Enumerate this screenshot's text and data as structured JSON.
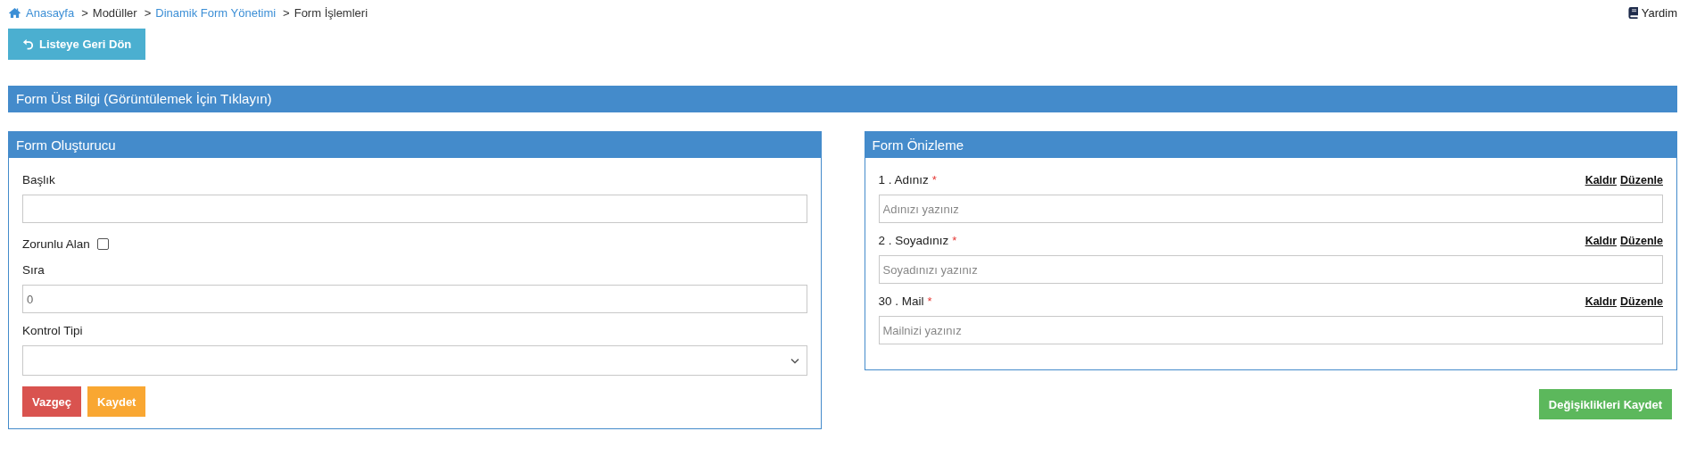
{
  "breadcrumb": [
    {
      "label": "Anasayfa",
      "link": true
    },
    {
      "label": "Modüller",
      "link": false,
      "sep": ">"
    },
    {
      "label": "Dinamik Form Yönetimi",
      "link": true,
      "sep": ">"
    },
    {
      "label": "Form İşlemleri",
      "link": false,
      "sep": ">"
    }
  ],
  "help": "Yardim",
  "back_button": "Listeye Geri Dön",
  "header_bar": "Form Üst Bilgi (Görüntülemek İçin Tıklayın)",
  "builder": {
    "title": "Form Oluşturucu",
    "fields": [
      {
        "kind": "text",
        "label": "Başlık"
      },
      {
        "kind": "checkbox",
        "label": "Zorunlu Alan",
        "checked": false
      },
      {
        "kind": "text",
        "label": "Sıra",
        "value": "0"
      },
      {
        "kind": "select",
        "label": "Kontrol Tipi"
      }
    ],
    "buttons": [
      {
        "label": "Vazgeç",
        "color": "#d9534f"
      },
      {
        "label": "Kaydet",
        "color": "#f9a732"
      }
    ]
  },
  "preview": {
    "title": "Form Önizleme",
    "items": [
      {
        "label": "1 . Adınız",
        "required": "*",
        "placeholder": "Adınızı yazınız",
        "remove": "Kaldır",
        "edit": "Düzenle"
      },
      {
        "label": "2 . Soyadınız",
        "required": "*",
        "placeholder": "Soyadınızı yazınız",
        "remove": "Kaldır",
        "edit": "Düzenle"
      },
      {
        "label": "30 . Mail",
        "required": "*",
        "placeholder": "Mailnizi yazınız",
        "remove": "Kaldır",
        "edit": "Düzenle"
      }
    ]
  },
  "save_button": "Değişiklikleri Kaydet"
}
